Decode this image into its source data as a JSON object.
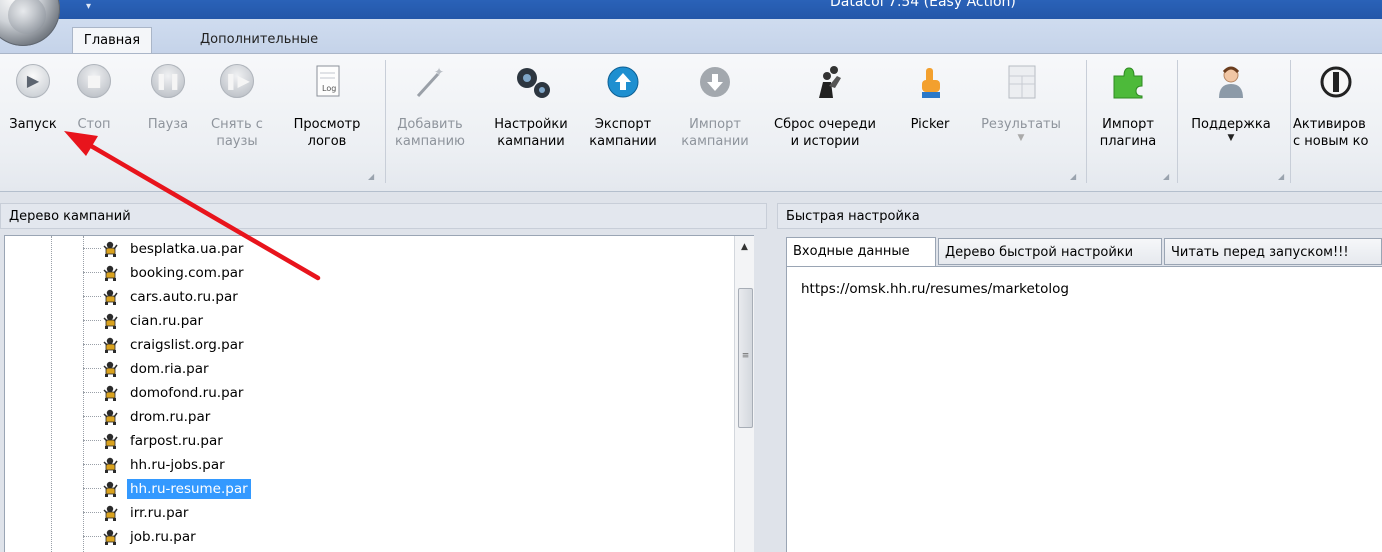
{
  "window": {
    "title": "Datacol 7.54 (Easy Action)"
  },
  "ribbon_tabs": [
    {
      "label": "Главная",
      "active": true
    },
    {
      "label": "Дополнительные",
      "active": false
    }
  ],
  "ribbon": {
    "start": {
      "line1": "Запуск",
      "line2": ""
    },
    "stop": {
      "line1": "Стоп",
      "line2": ""
    },
    "pause": {
      "line1": "Пауза",
      "line2": ""
    },
    "resume": {
      "line1": "Снять с",
      "line2": "паузы"
    },
    "logs": {
      "line1": "Просмотр",
      "line2": "логов"
    },
    "add_campaign": {
      "line1": "Добавить",
      "line2": "кампанию"
    },
    "campaign_settings": {
      "line1": "Настройки",
      "line2": "кампании"
    },
    "export_campaign": {
      "line1": "Экспорт",
      "line2": "кампании"
    },
    "import_campaign": {
      "line1": "Импорт",
      "line2": "кампании"
    },
    "reset_queue": {
      "line1": "Сброс очереди",
      "line2": "и истории"
    },
    "picker": {
      "line1": "Picker",
      "line2": ""
    },
    "results": {
      "line1": "Результаты",
      "line2": ""
    },
    "import_plugin": {
      "line1": "Импорт",
      "line2": "плагина"
    },
    "support": {
      "line1": "Поддержка",
      "line2": ""
    },
    "activate": {
      "line1": "Активиров",
      "line2": "с новым ко"
    }
  },
  "campaign_tree": {
    "title": "Дерево кампаний",
    "items": [
      "besplatka.ua.par",
      "booking.com.par",
      "cars.auto.ru.par",
      "cian.ru.par",
      "craigslist.org.par",
      "dom.ria.par",
      "domofond.ru.par",
      "drom.ru.par",
      "farpost.ru.par",
      "hh.ru-jobs.par",
      "hh.ru-resume.par",
      "irr.ru.par",
      "job.ru.par"
    ],
    "selected": "hh.ru-resume.par"
  },
  "quick_setup": {
    "title": "Быстрая настройка",
    "tabs": [
      "Входные данные",
      "Дерево быстрой настройки",
      "Читать перед запуском!!!"
    ],
    "input_text": "https://omsk.hh.ru/resumes/marketolog"
  },
  "colors": {
    "selection": "#3399ff",
    "annotation_arrow": "#e8141c",
    "titlebar": "#2a62b8"
  }
}
